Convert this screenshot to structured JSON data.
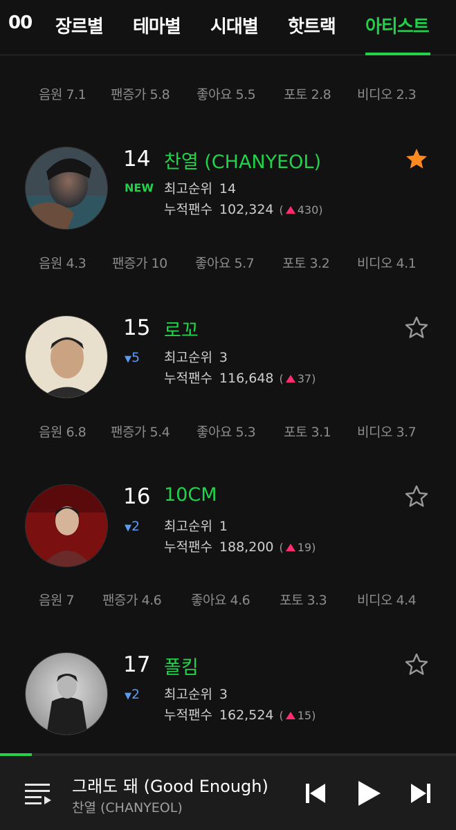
{
  "tabs": [
    {
      "label": "00"
    },
    {
      "label": "장르별"
    },
    {
      "label": "테마별"
    },
    {
      "label": "시대별"
    },
    {
      "label": "핫트랙"
    },
    {
      "label": "아티스트",
      "active": true
    }
  ],
  "top_stats": [
    {
      "label": "음원 7.1"
    },
    {
      "label": "팬증가 5.8"
    },
    {
      "label": "좋아요 5.5"
    },
    {
      "label": "포토 2.8"
    },
    {
      "label": "비디오 2.3"
    }
  ],
  "artists": [
    {
      "rank": "14",
      "change": "NEW",
      "change_type": "new",
      "name": "찬열 (CHANYEOL)",
      "best_rank_label": "최고순위",
      "best_rank": "14",
      "fans_label": "누적팬수",
      "fans": "102,324",
      "fans_delta": "430",
      "favorited": true,
      "stats": [
        "음원 4.3",
        "팬증가 10",
        "좋아요 5.7",
        "포토 3.2",
        "비디오 4.1"
      ]
    },
    {
      "rank": "15",
      "change": "5",
      "change_type": "down",
      "name": "로꼬",
      "best_rank_label": "최고순위",
      "best_rank": "3",
      "fans_label": "누적팬수",
      "fans": "116,648",
      "fans_delta": "37",
      "favorited": false,
      "stats": [
        "음원 6.8",
        "팬증가 5.4",
        "좋아요 5.3",
        "포토 3.1",
        "비디오 3.7"
      ]
    },
    {
      "rank": "16",
      "change": "2",
      "change_type": "down",
      "name": "10CM",
      "best_rank_label": "최고순위",
      "best_rank": "1",
      "fans_label": "누적팬수",
      "fans": "188,200",
      "fans_delta": "19",
      "favorited": false,
      "stats": [
        "음원 7",
        "팬증가 4.6",
        "좋아요 4.6",
        "포토 3.3",
        "비디오 4.4"
      ]
    },
    {
      "rank": "17",
      "change": "2",
      "change_type": "down",
      "name": "폴킴",
      "best_rank_label": "최고순위",
      "best_rank": "3",
      "fans_label": "누적팬수",
      "fans": "162,524",
      "fans_delta": "15",
      "favorited": false,
      "stats": []
    }
  ],
  "player": {
    "title": "그래도 돼 (Good Enough)",
    "artist": "찬열 (CHANYEOL)",
    "progress": 0.07
  },
  "colors": {
    "accent": "#22d34a",
    "background": "#121212",
    "favorite": "#ff8a1f",
    "down": "#5b9bf1",
    "up": "#ff2d6f"
  },
  "icons": {
    "favorite": "star-icon",
    "playlist": "playlist-icon",
    "prev": "skip-previous-icon",
    "play": "play-icon",
    "next": "skip-next-icon"
  }
}
